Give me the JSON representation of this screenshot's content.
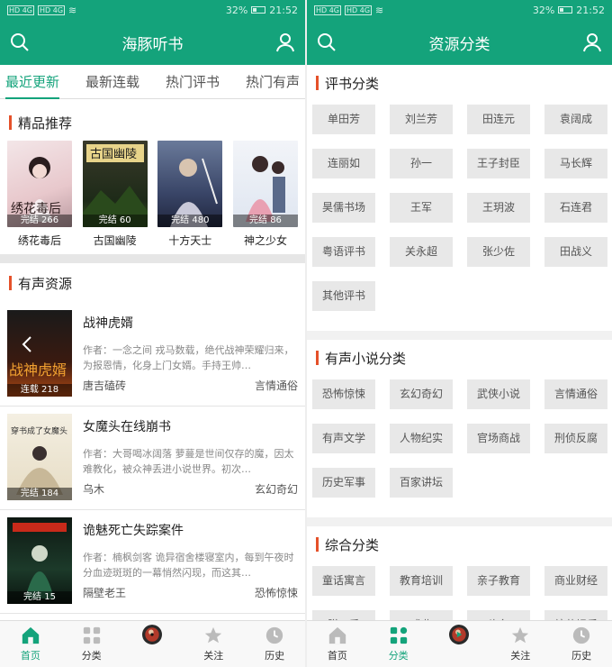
{
  "status_left": {
    "sig1": "HD 4G",
    "sig2": "HD 4G"
  },
  "status_battery": "32%",
  "status_time": "21:52",
  "s1": {
    "title": "海豚听书",
    "tabs": [
      "最近更新",
      "最新连载",
      "热门评书",
      "热门有声"
    ],
    "rec_title": "精品推荐",
    "rec": [
      {
        "name": "绣花毒后",
        "badge": "完结 266"
      },
      {
        "name": "古国幽陵",
        "badge": "完结 60"
      },
      {
        "name": "十方天士",
        "badge": "完结 480"
      },
      {
        "name": "神之少女",
        "badge": "完结 86"
      }
    ],
    "audio_title": "有声资源",
    "items": [
      {
        "title": "战神虎婿",
        "desc": "作者：一念之间 戎马数载，绝代战神荣耀归来，为报恩情，化身上门女婿。手持王帅…",
        "author": "唐吉磕砖",
        "genre": "言情通俗",
        "badge": "连载 218"
      },
      {
        "title": "女魔头在线崩书",
        "desc": "作者：大哥喝冰阔落 萝蔓是世间仅存的魔，因太难教化，被众神丢进小说世界。初次…",
        "author": "乌木",
        "genre": "玄幻奇幻",
        "badge": "完结 184"
      },
      {
        "title": "诡魅死亡失踪案件",
        "desc": "作者：楠枫剑客 诡异宿舍楼寝室内，每到午夜时分血迹斑斑的一幕悄然闪现，而这其…",
        "author": "隔壁老王",
        "genre": "恐怖惊悚",
        "badge": "完结 15"
      }
    ]
  },
  "s2": {
    "title": "资源分类",
    "sections": [
      {
        "title": "评书分类",
        "items": [
          "单田芳",
          "刘兰芳",
          "田连元",
          "袁阔成",
          "连丽如",
          "孙一",
          "王子封臣",
          "马长辉",
          "昊儒书场",
          "王军",
          "王玥波",
          "石连君",
          "粤语评书",
          "关永超",
          "张少佐",
          "田战义",
          "其他评书"
        ]
      },
      {
        "title": "有声小说分类",
        "items": [
          "恐怖惊悚",
          "玄幻奇幻",
          "武侠小说",
          "言情通俗",
          "有声文学",
          "人物纪实",
          "官场商战",
          "刑侦反腐",
          "历史军事",
          "百家讲坛"
        ]
      },
      {
        "title": "综合分类",
        "items": [
          "童话寓言",
          "教育培训",
          "亲子教育",
          "商业财经",
          "脱口秀",
          "戏曲",
          "头条",
          "综艺娱乐"
        ]
      }
    ]
  },
  "nav": [
    "首页",
    "分类",
    "",
    "关注",
    "历史"
  ],
  "colors": {
    "primary": "#14a37b",
    "accent": "#e5512a"
  }
}
